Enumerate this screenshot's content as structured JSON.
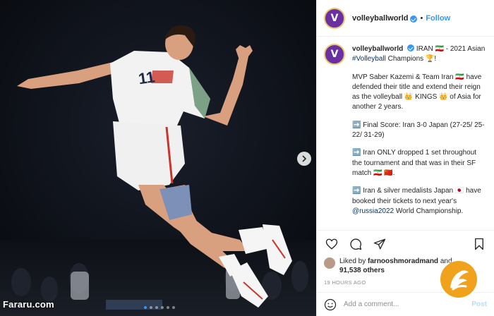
{
  "photo": {
    "jersey_number": "11",
    "watermark": "Fararu.com",
    "carousel_dot_count": 6,
    "carousel_active_index": 0,
    "next_icon": "chevron-right-icon"
  },
  "header": {
    "username": "volleyballworld",
    "separator": "•",
    "follow_label": "Follow",
    "avatar_letter": "V"
  },
  "caption": {
    "username": "volleyballworld",
    "line1_text": "IRAN 🇮🇷 - 2021 Asian ",
    "hashtag": "#Volleyball",
    "line1_end": " Champions 🏆!",
    "para2": "MVP Saber Kazemi & Team Iran 🇮🇷 have defended their title and extend their reign as the volleyball 👑 KINGS 👑 of Asia for another 2 years.",
    "para3": "➡️ Final Score: Iran 3-0 Japan (27-25/ 25-22/ 31-29)",
    "para4": "➡️ Iran ONLY dropped 1 set throughout the tournament and that was in their SF match 🇮🇷 🇨🇳.",
    "para5_start": "➡️ Iran & silver medalists Japan 🇯🇵 have booked their tickets to next year's ",
    "para5_mention": "@russia2022",
    "para5_end": " World Championship."
  },
  "actions": {
    "like_icon": "heart-icon",
    "comment_icon": "comment-icon",
    "share_icon": "share-icon",
    "save_icon": "bookmark-icon"
  },
  "likes": {
    "prefix": "Liked by ",
    "user": "farnooshmoradmand",
    "and": " and",
    "count": "91,538 others"
  },
  "timestamp": "19 HOURS AGO",
  "comment": {
    "placeholder": "Add a comment...",
    "post_label": "Post",
    "emoji_icon": "smiley-icon"
  },
  "colors": {
    "accent": "#3897f0",
    "brand_purple": "#6a2fa0",
    "badge_orange": "#f0a21c"
  }
}
